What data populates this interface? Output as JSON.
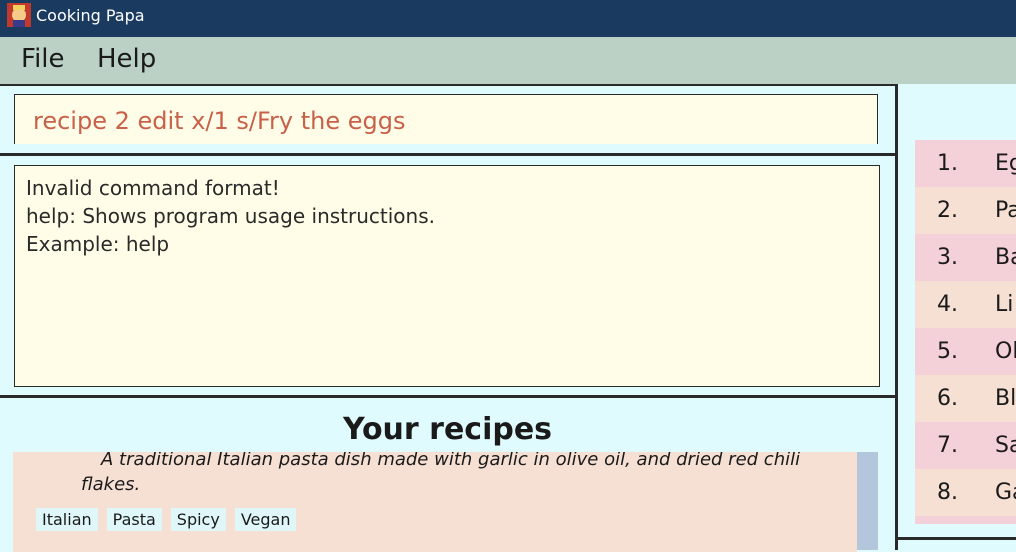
{
  "window": {
    "title": "Cooking Papa"
  },
  "menu": {
    "items": [
      "File",
      "Help"
    ]
  },
  "command": {
    "value": "recipe 2 edit x/1 s/Fry the eggs"
  },
  "result": {
    "lines": [
      "Invalid command format!",
      "help: Shows program usage instructions.",
      "Example: help"
    ]
  },
  "recipes": {
    "title": "Your recipes",
    "card": {
      "description": "A traditional Italian pasta dish made with garlic in olive oil, and dried red chili flakes.",
      "tags": [
        "Italian",
        "Pasta",
        "Spicy",
        "Vegan"
      ]
    }
  },
  "ingredients": {
    "items": [
      {
        "num": "1.",
        "name": "Eg"
      },
      {
        "num": "2.",
        "name": "Pa"
      },
      {
        "num": "3.",
        "name": "Ba"
      },
      {
        "num": "4.",
        "name": "Li"
      },
      {
        "num": "5.",
        "name": "Ol"
      },
      {
        "num": "6.",
        "name": "Bl"
      },
      {
        "num": "7.",
        "name": "Sa"
      },
      {
        "num": "8.",
        "name": "Ga"
      }
    ]
  },
  "colors": {
    "titlebar": "#1b3a5f",
    "menubar": "#bbd1c6",
    "panel": "#fffde8",
    "command_text": "#c8614a",
    "card": "#f6e0d4",
    "row_alt": "#f4d0d8",
    "background": "#dffbfd"
  }
}
